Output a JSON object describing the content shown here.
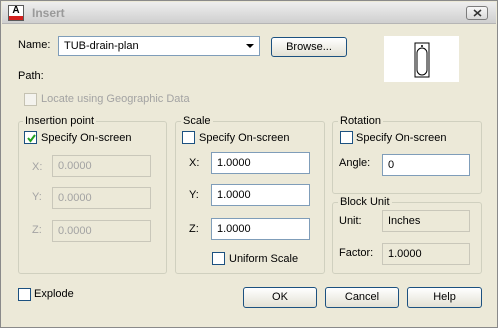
{
  "window": {
    "title": "Insert",
    "close_label": "X"
  },
  "name": {
    "label": "Name:",
    "value": "TUB-drain-plan",
    "browse_label": "Browse..."
  },
  "path": {
    "label": "Path:"
  },
  "geo": {
    "label": "Locate using Geographic Data",
    "checked": false
  },
  "insertion": {
    "title": "Insertion point",
    "specify_label": "Specify On-screen",
    "specify_checked": true,
    "x_label": "X:",
    "x_value": "0.0000",
    "y_label": "Y:",
    "y_value": "0.0000",
    "z_label": "Z:",
    "z_value": "0.0000"
  },
  "scale": {
    "title": "Scale",
    "specify_label": "Specify On-screen",
    "specify_checked": false,
    "x_label": "X:",
    "x_value": "1.0000",
    "y_label": "Y:",
    "y_value": "1.0000",
    "z_label": "Z:",
    "z_value": "1.0000",
    "uniform_label": "Uniform Scale",
    "uniform_checked": false
  },
  "rotation": {
    "title": "Rotation",
    "specify_label": "Specify On-screen",
    "specify_checked": false,
    "angle_label": "Angle:",
    "angle_value": "0"
  },
  "block_unit": {
    "title": "Block Unit",
    "unit_label": "Unit:",
    "unit_value": "Inches",
    "factor_label": "Factor:",
    "factor_value": "1.0000"
  },
  "explode": {
    "label": "Explode",
    "checked": false
  },
  "buttons": {
    "ok": "OK",
    "cancel": "Cancel",
    "help": "Help"
  },
  "colors": {
    "accent_border": "#1c5180",
    "field_border": "#7f9db9",
    "dialog_bg": "#ece9d8",
    "disabled_text": "#a3a3a3"
  }
}
